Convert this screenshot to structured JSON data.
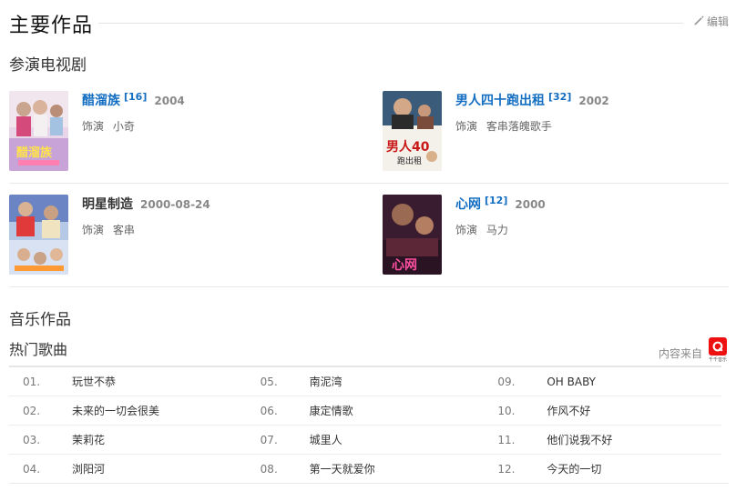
{
  "header": {
    "title": "主要作品",
    "edit_label": "编辑"
  },
  "tv_section": {
    "title": "参演电视剧",
    "items": [
      {
        "name": "醋溜族",
        "ref": "[16]",
        "year": "2004",
        "role_label": "饰演",
        "role": "小奇"
      },
      {
        "name": "男人四十跑出租",
        "ref": "[32]",
        "year": "2002",
        "role_label": "饰演",
        "role": "客串落魄歌手"
      },
      {
        "name": "明星制造",
        "ref": "",
        "year": "2000-08-24",
        "role_label": "饰演",
        "role": "客串"
      },
      {
        "name": "心网",
        "ref": "[12]",
        "year": "2000",
        "role_label": "饰演",
        "role": "马力"
      }
    ]
  },
  "music_section": {
    "title": "音乐作品",
    "subtitle": "热门歌曲",
    "source_label": "内容来自",
    "source_logo_caption": "千千音乐",
    "songs": [
      {
        "num": "01.",
        "name": "玩世不恭"
      },
      {
        "num": "02.",
        "name": "未来的一切会很美"
      },
      {
        "num": "03.",
        "name": "茉莉花"
      },
      {
        "num": "04.",
        "name": "浏阳河"
      },
      {
        "num": "05.",
        "name": "南泥湾"
      },
      {
        "num": "06.",
        "name": "康定情歌"
      },
      {
        "num": "07.",
        "name": "城里人"
      },
      {
        "num": "08.",
        "name": "第一天就爱你"
      },
      {
        "num": "09.",
        "name": "OH BABY"
      },
      {
        "num": "10.",
        "name": "作风不好"
      },
      {
        "num": "11.",
        "name": "他们说我不好"
      },
      {
        "num": "12.",
        "name": "今天的一切"
      }
    ]
  },
  "colors": {
    "link": "#136ec2",
    "logo_red": "#ee1111"
  }
}
